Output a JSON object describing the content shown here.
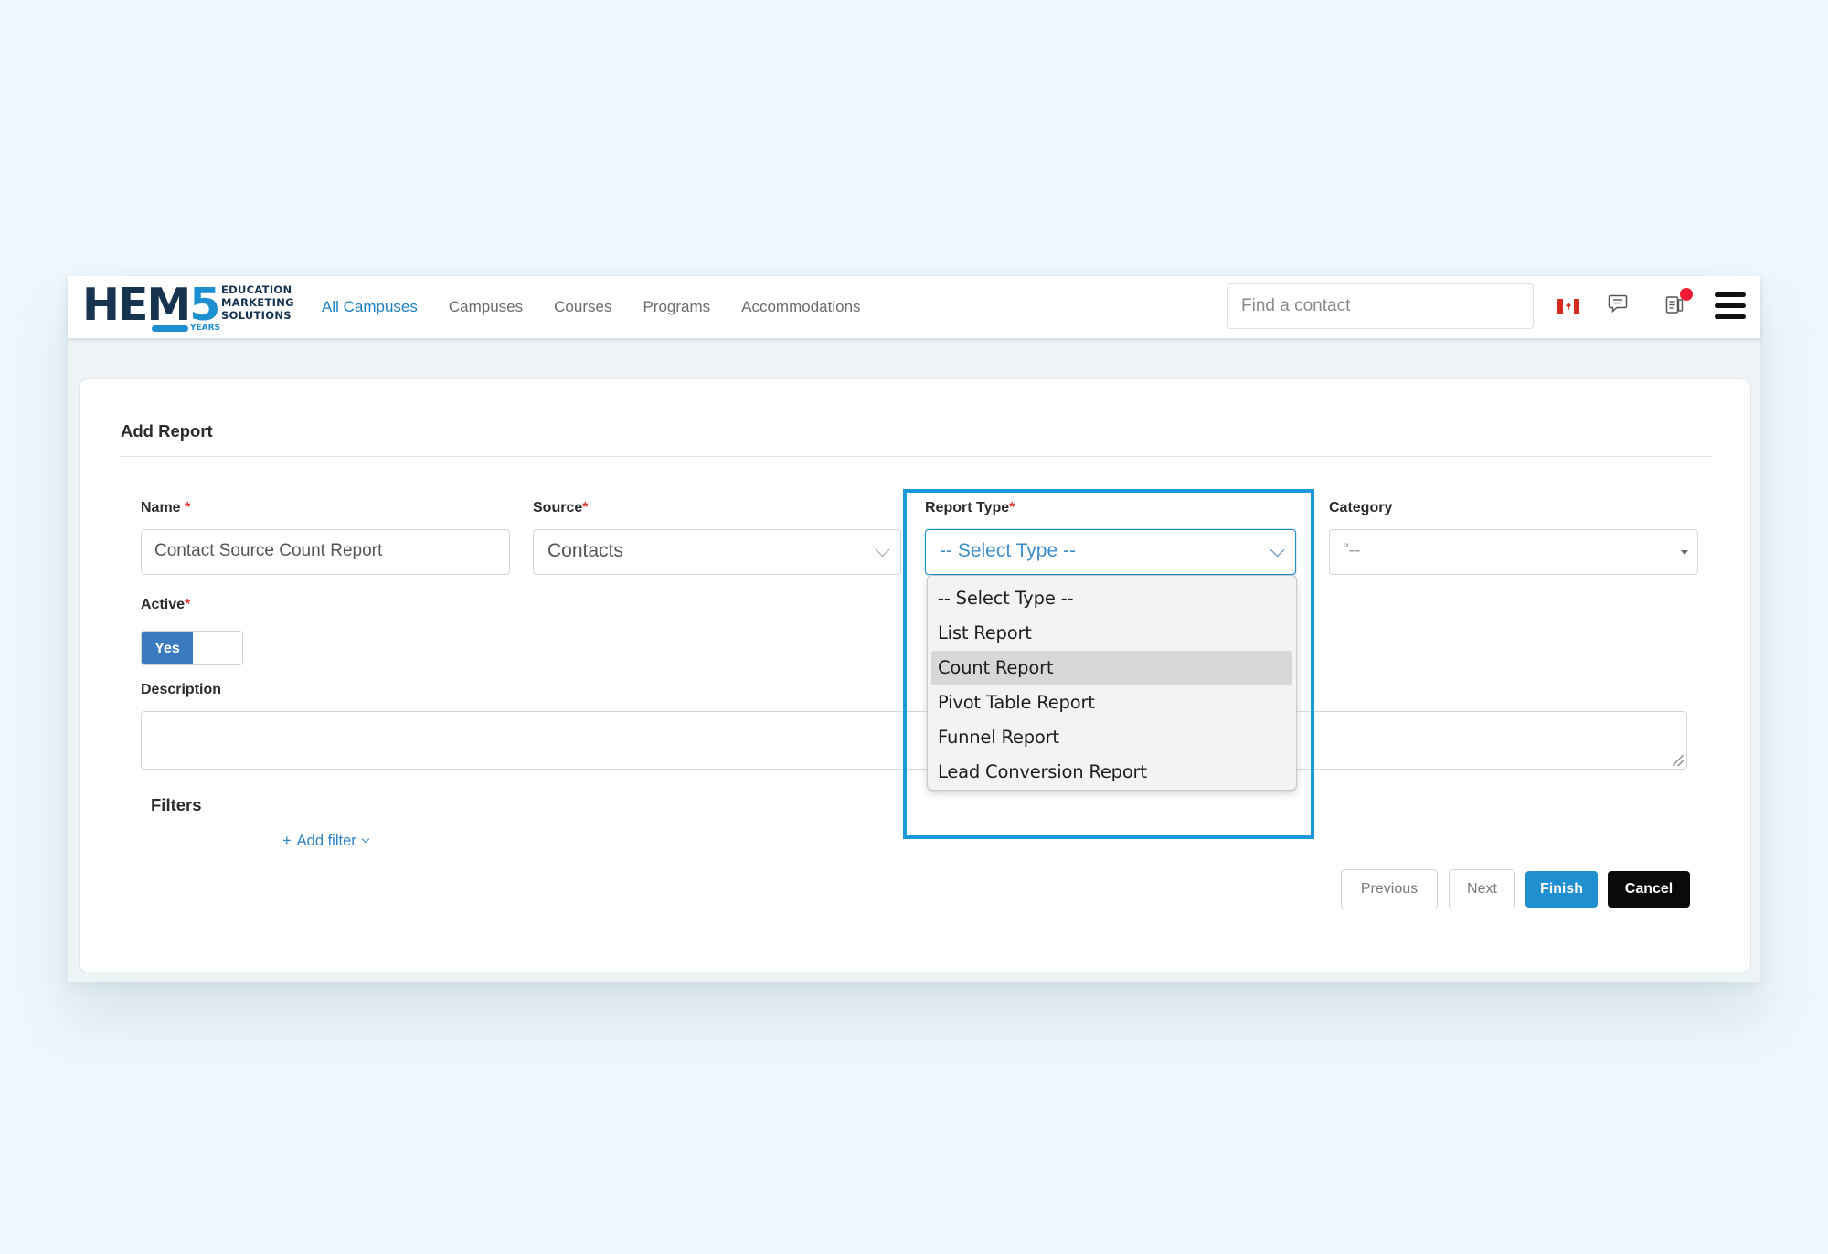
{
  "logo": {
    "main_text": "HEM",
    "main_number": "5",
    "sub_lines": [
      "EDUCATION",
      "MARKETING",
      "SOLUTIONS"
    ],
    "years_label": "YEARS"
  },
  "nav": {
    "items": [
      {
        "label": "All Campuses",
        "active": true
      },
      {
        "label": "Campuses",
        "active": false
      },
      {
        "label": "Courses",
        "active": false
      },
      {
        "label": "Programs",
        "active": false
      },
      {
        "label": "Accommodations",
        "active": false
      }
    ]
  },
  "header": {
    "search_placeholder": "Find a contact",
    "flag_icon": "canada-flag-icon",
    "chat_icon": "message-icon",
    "docs_icon": "document-icon",
    "notification_dot_color": "#f21b33",
    "menu_icon": "hamburger-menu-icon"
  },
  "form": {
    "title": "Add Report",
    "name": {
      "label": "Name",
      "required": "*",
      "value": "Contact Source Count Report"
    },
    "source": {
      "label": "Source",
      "required": "*",
      "value": "Contacts"
    },
    "report_type": {
      "label": "Report Type",
      "required": "*",
      "value": "-- Select Type --",
      "options": [
        "-- Select Type --",
        "List Report",
        "Count Report",
        "Pivot Table Report",
        "Funnel Report",
        "Lead Conversion Report"
      ],
      "hovered_option": "Count Report"
    },
    "category": {
      "label": "Category",
      "value": "\"--"
    },
    "active": {
      "label": "Active",
      "required": "*",
      "value": "Yes"
    },
    "description": {
      "label": "Description",
      "value": ""
    },
    "filters": {
      "title": "Filters",
      "add_filter_plus": "+",
      "add_filter_label": "Add filter"
    }
  },
  "buttons": {
    "previous": "Previous",
    "next": "Next",
    "finish": "Finish",
    "cancel": "Cancel"
  },
  "colors": {
    "accent": "#1f8fd0",
    "highlight_border": "#1a9ad8",
    "toggle_on": "#3a7bbf",
    "required": "#e03a3a"
  }
}
